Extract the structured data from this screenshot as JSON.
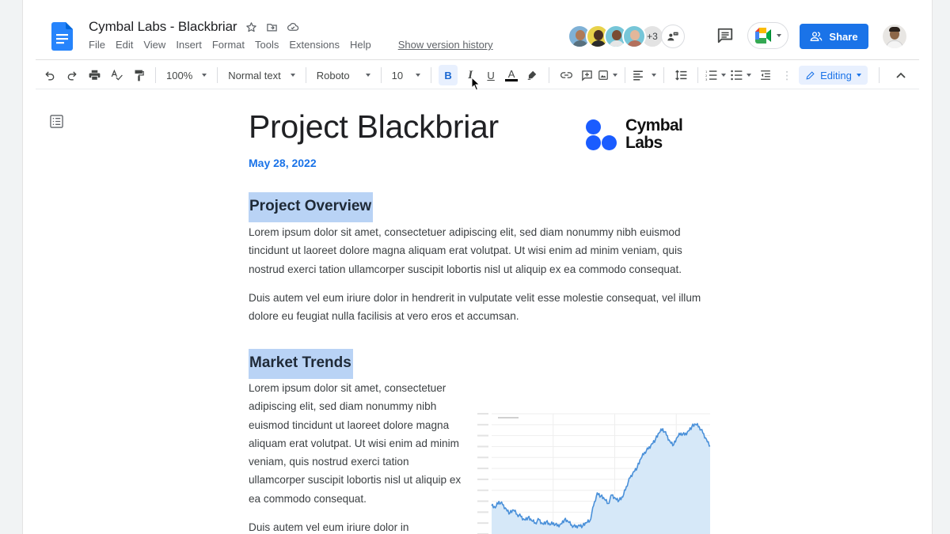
{
  "app": {
    "doc_title": "Cymbal Labs - Blackbriar",
    "menu": [
      "File",
      "Edit",
      "View",
      "Insert",
      "Format",
      "Tools",
      "Extensions",
      "Help"
    ],
    "version_history_link": "Show version history",
    "title_icons": [
      "star-icon",
      "move-to-folder-icon",
      "cloud-saved-icon"
    ]
  },
  "collaborators": {
    "avatars": [
      {
        "name": "collaborator-1",
        "ring": "#7fb1d6",
        "skin": "#b07a57",
        "shirt": "#58707e"
      },
      {
        "name": "collaborator-2",
        "ring": "#e8d24a",
        "skin": "#4a3024",
        "shirt": "#2b2b2b"
      },
      {
        "name": "collaborator-3",
        "ring": "#76c6d8",
        "skin": "#7a4c33",
        "shirt": "#e6e6e6"
      },
      {
        "name": "collaborator-4",
        "ring": "#76c6d8",
        "skin": "#e2b79a",
        "shirt": "#b3705c"
      }
    ],
    "more_count": "+3"
  },
  "header": {
    "share_label": "Share",
    "comment_icon": "comment-history-icon",
    "meet_icon": "google-meet-icon"
  },
  "toolbar": {
    "zoom": "100%",
    "style": "Normal text",
    "font": "Roboto",
    "font_size": "10",
    "bold": "B",
    "italic": "I",
    "underline": "U",
    "text_color": "A",
    "mode": "Editing"
  },
  "document": {
    "heading": "Project Blackbriar",
    "date": "May 28, 2022",
    "brand": {
      "line1": "Cymbal",
      "line2": "Labs",
      "color": "#1a5cff"
    },
    "sections": [
      {
        "title": "Project Overview",
        "paragraphs": [
          "Lorem ipsum dolor sit amet, consectetuer adipiscing elit, sed diam nonummy nibh euismod tincidunt ut laoreet dolore magna aliquam erat volutpat. Ut wisi enim ad minim veniam, quis nostrud exerci tation ullamcorper suscipit lobortis nisl ut aliquip ex ea commodo consequat.",
          "Duis autem vel eum iriure dolor in hendrerit in vulputate velit esse molestie consequat, vel illum dolore eu feugiat nulla facilisis at vero eros et accumsan."
        ]
      },
      {
        "title": "Market Trends",
        "paragraphs": [
          "Lorem ipsum dolor sit amet, consectetuer adipiscing elit, sed diam nonummy nibh euismod tincidunt ut laoreet dolore magna aliquam erat volutpat. Ut wisi enim ad minim veniam, quis nostrud exerci tation ullamcorper suscipit lobortis nisl ut aliquip ex ea commodo consequat.",
          "Duis autem vel eum iriure dolor in"
        ]
      }
    ]
  },
  "chart_data": {
    "type": "area",
    "title": "",
    "xlabel": "",
    "ylabel": "",
    "grid": true,
    "legend": "none",
    "series": [
      {
        "name": "trend",
        "color": "#4a90d9",
        "fill": "#d6e8f8",
        "values": [
          22,
          20,
          26,
          23,
          19,
          15,
          18,
          14,
          12,
          9,
          11,
          8,
          6,
          9,
          5,
          7,
          4,
          6,
          3,
          5,
          9,
          7,
          4,
          2,
          4,
          3,
          6,
          8,
          22,
          34,
          31,
          28,
          24,
          32,
          29,
          27,
          30,
          40,
          48,
          54,
          58,
          66,
          72,
          75,
          80,
          84,
          90,
          94,
          88,
          82,
          79,
          86,
          90,
          88,
          92,
          96,
          98,
          96,
          90,
          84,
          78
        ]
      }
    ],
    "ylim": [
      0,
      105
    ]
  }
}
